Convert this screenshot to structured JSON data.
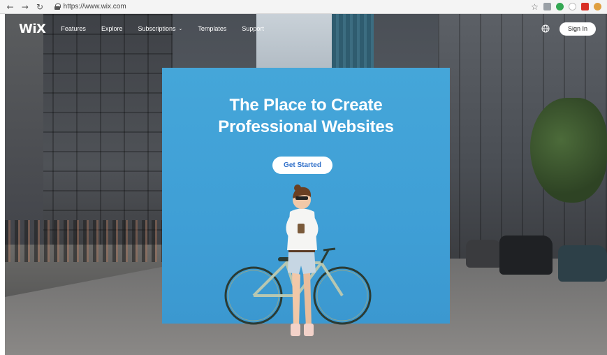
{
  "browser": {
    "back_icon": "arrow-left",
    "forward_icon": "arrow-right",
    "reload_icon": "reload",
    "url": "https://www.wix.com",
    "extensions": [
      {
        "name": "star-icon",
        "color": "#666666"
      },
      {
        "name": "extension-doc-icon",
        "color": "#9aa0a6"
      },
      {
        "name": "extension-green-icon",
        "color": "#34a853"
      },
      {
        "name": "extension-circle-icon",
        "color": "#bdbdbd"
      },
      {
        "name": "extension-red-icon",
        "color": "#d93025"
      },
      {
        "name": "profile-avatar-icon",
        "color": "#e0a040"
      }
    ]
  },
  "site": {
    "logo": "WiX",
    "nav": [
      {
        "label": "Features"
      },
      {
        "label": "Explore"
      },
      {
        "label": "Subscriptions",
        "has_dropdown": true
      },
      {
        "label": "Templates"
      },
      {
        "label": "Support"
      }
    ],
    "globe_icon": "globe",
    "signin_label": "Sign In"
  },
  "hero": {
    "title_line1": "The Place to Create",
    "title_line2": "Professional Websites",
    "cta_label": "Get Started"
  },
  "colors": {
    "backdrop": "#41a2d8",
    "cta_text": "#2f6fc9"
  }
}
